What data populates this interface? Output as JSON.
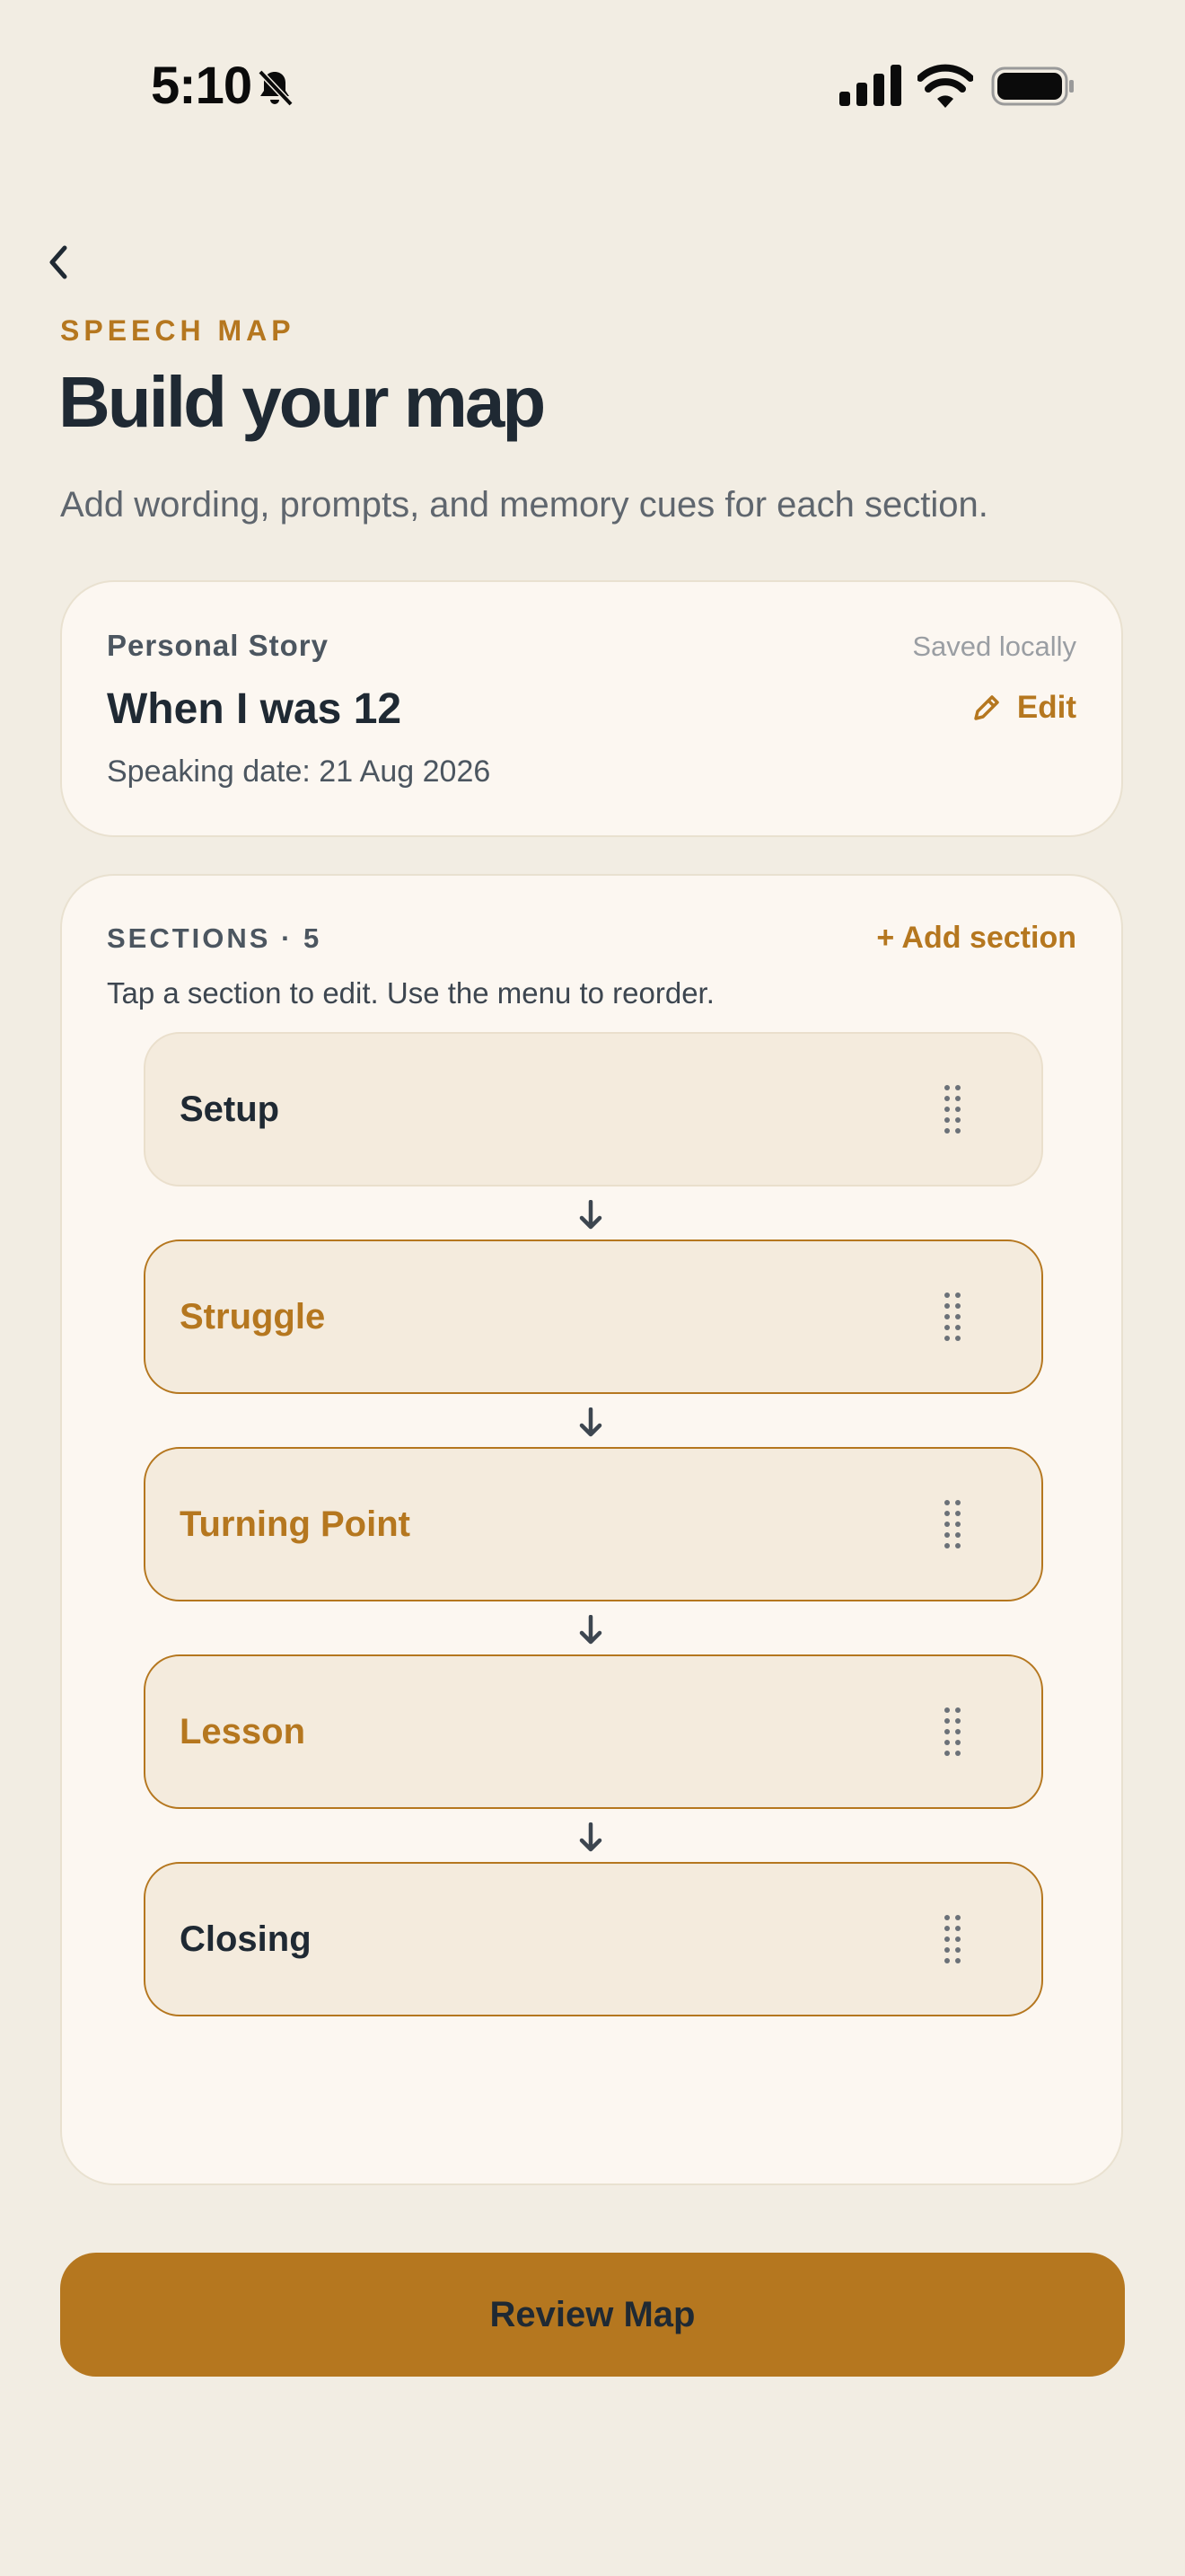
{
  "status_bar": {
    "time": "5:10",
    "icons": [
      "bell-slash-icon",
      "cellular-signal-icon",
      "wifi-icon",
      "battery-icon"
    ]
  },
  "header": {
    "back_icon": "chevron-left-icon",
    "eyebrow": "SPEECH MAP",
    "title": "Build your map",
    "subtitle": "Add wording, prompts, and memory cues for each section."
  },
  "story": {
    "type": "Personal Story",
    "save_status": "Saved locally",
    "title": "When I was 12",
    "edit_label": "Edit",
    "edit_icon": "pencil-icon",
    "speaking_date": "Speaking date: 21 Aug 2026"
  },
  "sections": {
    "header": "SECTIONS · 5",
    "add_label": "+ Add section",
    "hint": "Tap a section to edit. Use the menu to reorder.",
    "items": [
      {
        "label": "Setup",
        "style": "dark"
      },
      {
        "label": "Struggle",
        "style": "accent"
      },
      {
        "label": "Turning Point",
        "style": "accent"
      },
      {
        "label": "Lesson",
        "style": "accent"
      },
      {
        "label": "Closing",
        "style": "dark"
      }
    ],
    "connector_icon": "arrow-down-icon",
    "handle_icon": "drag-handle-icon"
  },
  "footer": {
    "review_label": "Review Map"
  },
  "colors": {
    "background": "#f2ede3",
    "card": "#fcf7f1",
    "accent": "#b5771f",
    "text_dark": "#1f2933",
    "text_muted": "#5f666e"
  }
}
